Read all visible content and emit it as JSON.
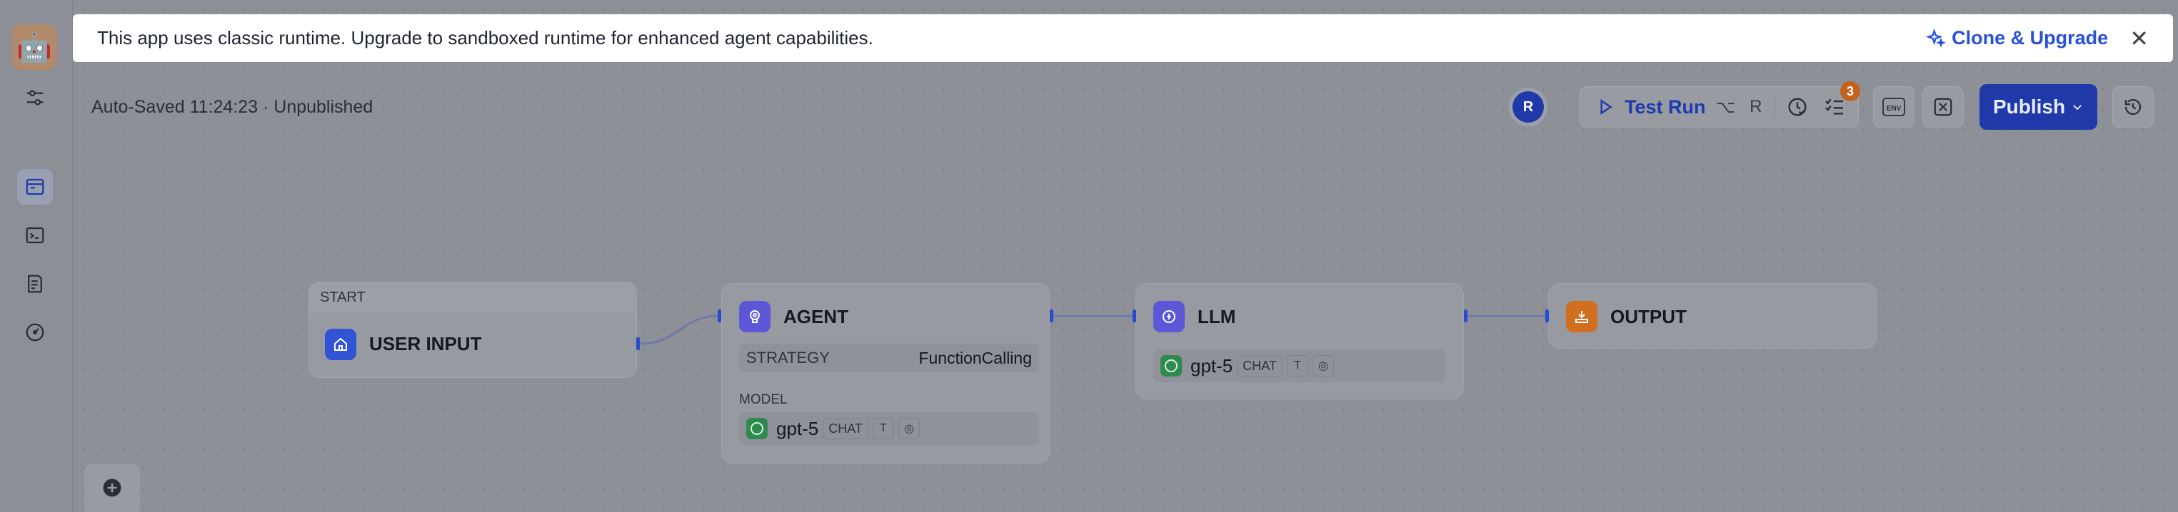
{
  "banner": {
    "message": "This app uses classic runtime. Upgrade to sandboxed runtime for enhanced agent capabilities.",
    "action_label": "Clone & Upgrade"
  },
  "status": {
    "autosave": "Auto-Saved 11:24:23 · Unpublished"
  },
  "toolbar": {
    "avatar_initial": "R",
    "test_run_label": "Test Run",
    "shortcut_1": "⌥",
    "shortcut_2": "R",
    "checklist_count": "3",
    "env_label": "ENV",
    "publish_label": "Publish"
  },
  "nodes": {
    "start": {
      "header": "START",
      "title": "USER INPUT"
    },
    "agent": {
      "title": "AGENT",
      "strategy_label": "STRATEGY",
      "strategy_value": "FunctionCalling",
      "model_label": "MODEL",
      "model_name": "gpt-5",
      "model_tag": "CHAT"
    },
    "llm": {
      "title": "LLM",
      "model_name": "gpt-5",
      "model_tag": "CHAT"
    },
    "output": {
      "title": "OUTPUT"
    }
  },
  "colors": {
    "accent": "#2950d6",
    "publish_bg": "#1f3aa8",
    "badge": "#c4621d",
    "agent_icon": "#5b57d6",
    "llm_icon": "#5b57d6",
    "start_icon": "#3153d6",
    "output_icon": "#d26f1e"
  },
  "icons": {
    "sidebar": [
      "app-icon",
      "settings-sliders-icon",
      "workflow-icon",
      "terminal-icon",
      "logs-icon",
      "monitor-gauge-icon"
    ],
    "toolbar": [
      "play-icon",
      "clock-check-icon",
      "checklist-icon",
      "env-icon",
      "variable-x-icon",
      "chevron-down-icon",
      "history-icon"
    ]
  }
}
